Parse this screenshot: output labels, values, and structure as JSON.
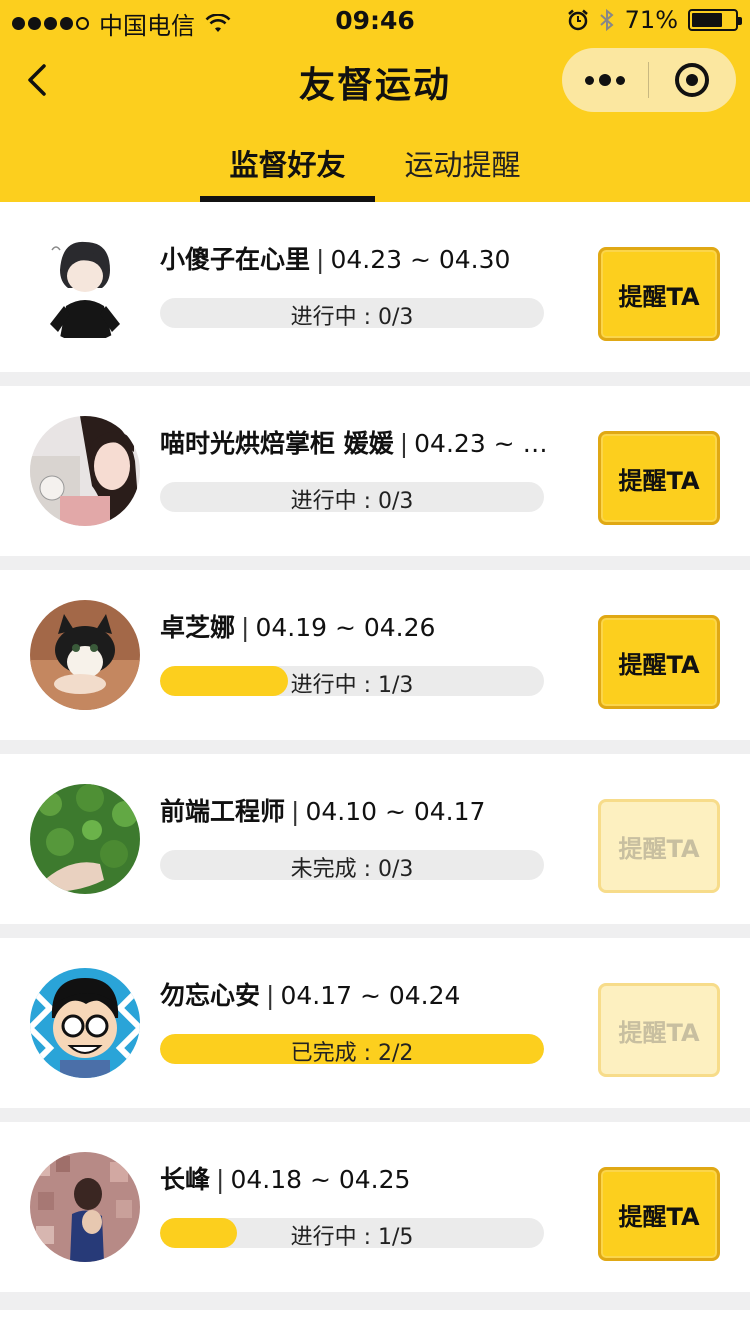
{
  "status_bar": {
    "carrier": "中国电信",
    "time": "09:46",
    "battery": "71%",
    "battery_level": 0.71
  },
  "nav": {
    "title": "友督运动"
  },
  "tabs": [
    {
      "label": "监督好友",
      "active": true
    },
    {
      "label": "运动提醒",
      "active": false
    }
  ],
  "colors": {
    "brand": "#fccf1e",
    "progress_bg": "#ebebeb"
  },
  "items": [
    {
      "name": "小傻子在心里",
      "date": "04.23 ~ 04.30",
      "status": "进行中 : 0/3",
      "progress": 0.0,
      "remind": "提醒TA",
      "remind_enabled": true,
      "avatar": "boy-cartoon-avatar"
    },
    {
      "name": "喵时光烘焙掌柜 媛媛",
      "date": "04.23 ~ 0...",
      "status": "进行中 : 0/3",
      "progress": 0.0,
      "remind": "提醒TA",
      "remind_enabled": true,
      "avatar": "girl-photo-avatar"
    },
    {
      "name": "卓芝娜",
      "date": "04.19 ~ 04.26",
      "status": "进行中 : 1/3",
      "progress": 0.333,
      "remind": "提醒TA",
      "remind_enabled": true,
      "avatar": "kitten-avatar"
    },
    {
      "name": "前端工程师",
      "date": "04.10 ~ 04.17",
      "status": "未完成 : 0/3",
      "progress": 0.0,
      "remind": "提醒TA",
      "remind_enabled": false,
      "avatar": "clover-avatar"
    },
    {
      "name": "勿忘心安",
      "date": "04.17 ~ 04.24",
      "status": "已完成 : 2/2",
      "progress": 1.0,
      "remind": "提醒TA",
      "remind_enabled": false,
      "avatar": "glasses-cartoon-avatar"
    },
    {
      "name": "长峰",
      "date": "04.18 ~ 04.25",
      "status": "进行中 : 1/5",
      "progress": 0.2,
      "remind": "提醒TA",
      "remind_enabled": true,
      "avatar": "photo-wall-avatar"
    }
  ]
}
